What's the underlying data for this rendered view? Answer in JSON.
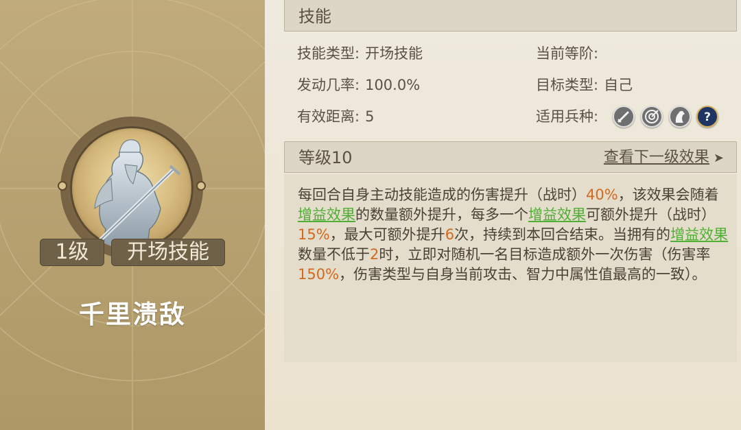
{
  "skill": {
    "name": "千里溃敌",
    "level_tag": "1级",
    "type_tag": "开场技能"
  },
  "skill_section": {
    "title": "技能",
    "rows": [
      {
        "label": "技能类型:",
        "value": "开场技能"
      },
      {
        "label": "发动几率:",
        "value": "100.0%"
      },
      {
        "label": "有效距离:",
        "value": "5"
      },
      {
        "label": "当前等阶:",
        "value": ""
      },
      {
        "label": "目标类型:",
        "value": "自己"
      },
      {
        "label": "适用兵种:",
        "value": ""
      }
    ],
    "unit_icons": [
      "infantry-sword-icon",
      "archer-target-icon",
      "cavalry-horse-icon",
      "unknown-question-icon"
    ]
  },
  "level_section": {
    "title": "等级10",
    "next_link": "查看下一级效果",
    "next_arrow": "➤"
  },
  "description": {
    "segments": [
      {
        "t": "每回合自身主动技能造成的伤害提升（战时）",
        "s": "plain"
      },
      {
        "t": "40%",
        "s": "orange"
      },
      {
        "t": "，该效果会随着",
        "s": "plain"
      },
      {
        "t": "增益效果",
        "s": "green"
      },
      {
        "t": "的数量额外提升，每多一个",
        "s": "plain"
      },
      {
        "t": "增益效果",
        "s": "green"
      },
      {
        "t": "可额外提升（战时）",
        "s": "plain"
      },
      {
        "t": "15%",
        "s": "orange"
      },
      {
        "t": "，最大可额外提升",
        "s": "plain"
      },
      {
        "t": "6",
        "s": "orange"
      },
      {
        "t": "次，持续到本回合结束。当拥有的",
        "s": "plain"
      },
      {
        "t": "增益效果",
        "s": "green"
      },
      {
        "t": "数量不低于",
        "s": "plain"
      },
      {
        "t": "2",
        "s": "orange"
      },
      {
        "t": "时，立即对随机一名目标造成额外一次伤害（伤害率",
        "s": "plain"
      },
      {
        "t": "150%",
        "s": "orange"
      },
      {
        "t": "，伤害类型与自身当前攻击、智力中属性值最高的一致）。",
        "s": "plain"
      }
    ]
  },
  "colors": {
    "highlight_number": "#d2691e",
    "highlight_link": "#4fae34",
    "card_bg": "#b6a070"
  }
}
